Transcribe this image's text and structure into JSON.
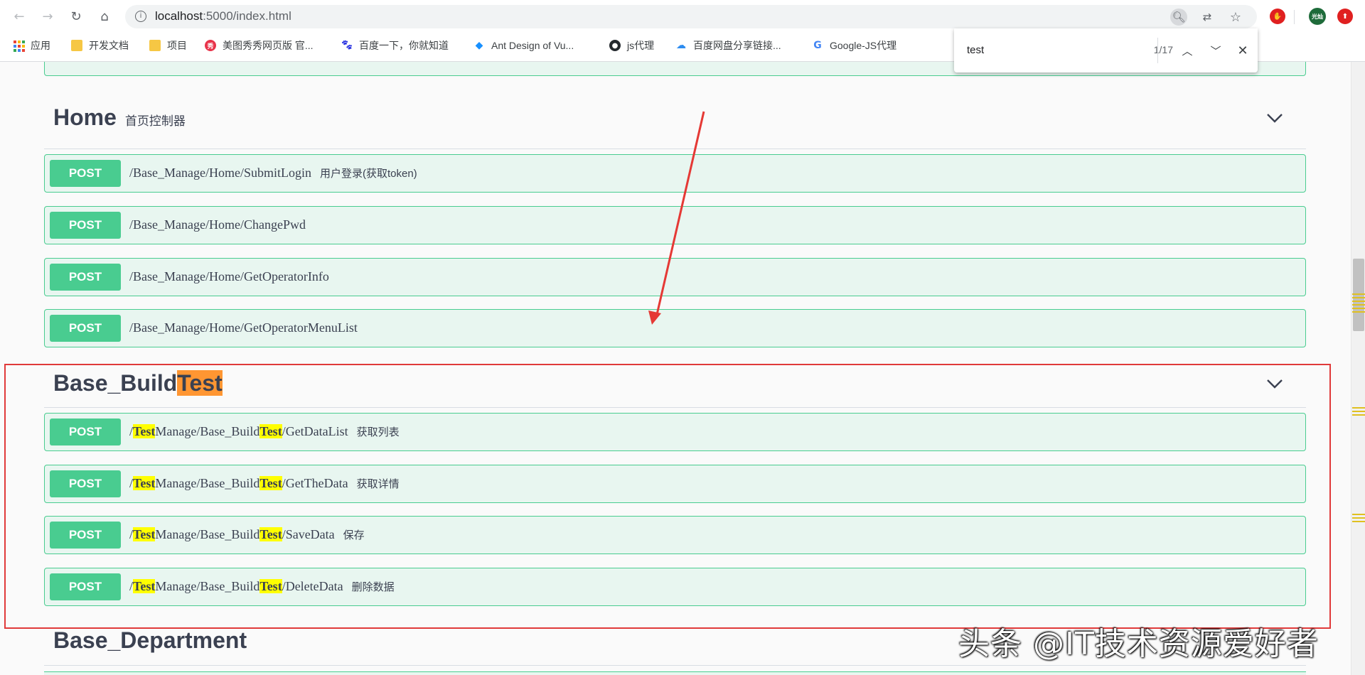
{
  "browser": {
    "url_host": "localhost",
    "url_rest": ":5000/index.html",
    "bookmarks": [
      {
        "label": "应用"
      },
      {
        "label": "开发文档"
      },
      {
        "label": "项目"
      },
      {
        "label": "美图秀秀网页版 官..."
      },
      {
        "label": "百度一下，你就知道"
      },
      {
        "label": "Ant Design of Vu..."
      },
      {
        "label": "js代理"
      },
      {
        "label": "百度网盘分享链接..."
      },
      {
        "label": "Google-JS代理"
      }
    ],
    "profile_label": "光灿"
  },
  "findbar": {
    "query": "test",
    "count": "1/17"
  },
  "sections": [
    {
      "title": "Home",
      "description": "首页控制器",
      "operations": [
        {
          "method": "POST",
          "path": "/Base_Manage/Home/SubmitLogin",
          "summary": "用户登录(获取token)"
        },
        {
          "method": "POST",
          "path": "/Base_Manage/Home/ChangePwd",
          "summary": ""
        },
        {
          "method": "POST",
          "path": "/Base_Manage/Home/GetOperatorInfo",
          "summary": ""
        },
        {
          "method": "POST",
          "path": "/Base_Manage/Home/GetOperatorMenuList",
          "summary": ""
        }
      ]
    },
    {
      "title_prefix": "Base_Build",
      "title_match": "Test",
      "operations": [
        {
          "method": "POST",
          "p1": "/",
          "m1": "Test",
          "p2": "Manage/Base_Build",
          "m2": "Test",
          "p3": "/GetDataList",
          "summary": "获取列表"
        },
        {
          "method": "POST",
          "p1": "/",
          "m1": "Test",
          "p2": "Manage/Base_Build",
          "m2": "Test",
          "p3": "/GetTheData",
          "summary": "获取详情"
        },
        {
          "method": "POST",
          "p1": "/",
          "m1": "Test",
          "p2": "Manage/Base_Build",
          "m2": "Test",
          "p3": "/SaveData",
          "summary": "保存"
        },
        {
          "method": "POST",
          "p1": "/",
          "m1": "Test",
          "p2": "Manage/Base_Build",
          "m2": "Test",
          "p3": "/DeleteData",
          "summary": "删除数据"
        }
      ]
    },
    {
      "title": "Base_Department"
    }
  ],
  "watermark": "头条 @IT技术资源爱好者",
  "colors": {
    "post_green": "#49cc90",
    "post_bg": "#e8f6f0",
    "annotation_red": "#e03a3a",
    "find_match": "#ffff00",
    "find_active": "#ff9632"
  }
}
